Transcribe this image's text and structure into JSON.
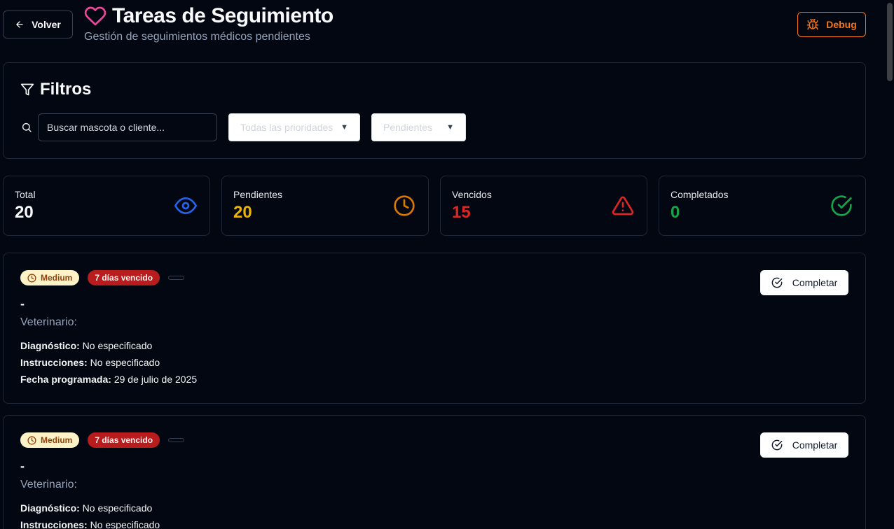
{
  "header": {
    "back_label": "Volver",
    "title": "Tareas de Seguimiento",
    "subtitle": "Gestión de seguimientos médicos pendientes",
    "debug_label": "Debug"
  },
  "filters": {
    "title": "Filtros",
    "search_placeholder": "Buscar mascota o cliente...",
    "priority_selected": "Todas las prioridades",
    "status_selected": "Pendientes"
  },
  "stats": [
    {
      "label": "Total",
      "value": "20",
      "color": "#f9fafb",
      "icon": "eye-icon",
      "icon_color": "#2563eb"
    },
    {
      "label": "Pendientes",
      "value": "20",
      "color": "#eab308",
      "icon": "clock-icon",
      "icon_color": "#d97706"
    },
    {
      "label": "Vencidos",
      "value": "15",
      "color": "#dc2626",
      "icon": "alert-triangle-icon",
      "icon_color": "#dc2626"
    },
    {
      "label": "Completados",
      "value": "0",
      "color": "#16a34a",
      "icon": "check-circle-icon",
      "icon_color": "#16a34a"
    }
  ],
  "tasks": [
    {
      "priority": "Medium",
      "overdue": "7 días vencido",
      "name": "-",
      "vet_label": "Veterinario:",
      "diagnosis_label": "Diagnóstico:",
      "diagnosis": "No especificado",
      "instructions_label": "Instrucciones:",
      "instructions": "No especificado",
      "date_label": "Fecha programada:",
      "date": "29 de julio de 2025",
      "complete_label": "Completar"
    },
    {
      "priority": "Medium",
      "overdue": "7 días vencido",
      "name": "-",
      "vet_label": "Veterinario:",
      "diagnosis_label": "Diagnóstico:",
      "diagnosis": "No especificado",
      "instructions_label": "Instrucciones:",
      "instructions": "No especificado",
      "complete_label": "Completar"
    }
  ]
}
